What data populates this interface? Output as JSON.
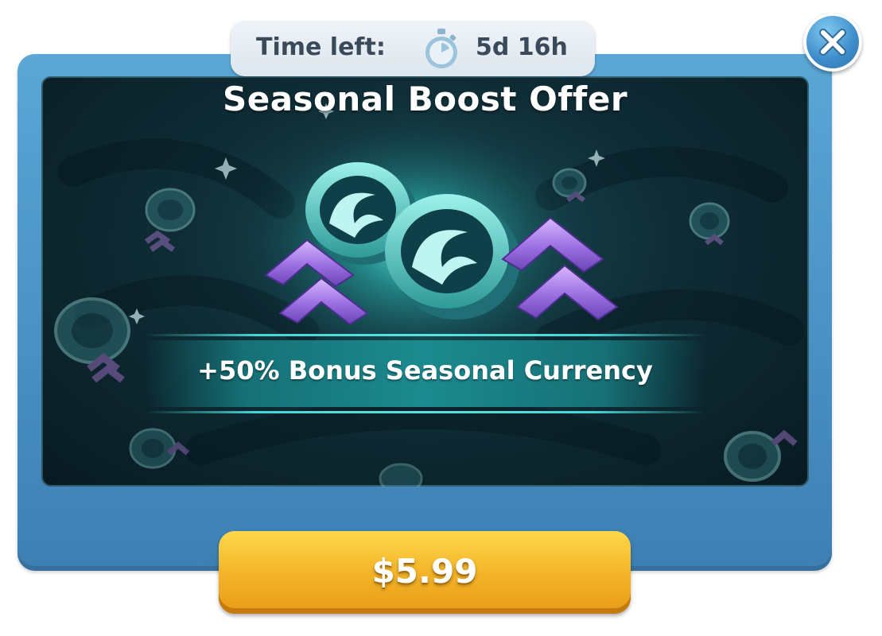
{
  "timer": {
    "label": "Time left:",
    "icon": "stopwatch-icon",
    "value": "5d 16h"
  },
  "offer": {
    "title": "Seasonal Boost Offer",
    "bonus_text": "+50% Bonus Seasonal Currency",
    "artwork": [
      "wave-coin-icon",
      "wave-coin-icon",
      "boost-arrows-icon",
      "boost-arrows-icon"
    ]
  },
  "buy_button": {
    "price": "$5.99"
  },
  "close_button": {
    "icon": "close-icon"
  },
  "colors": {
    "frame": "#4a91c4",
    "panel": "#0f2d36",
    "accent_teal": "#1b8a8e",
    "glow": "#48d6d2",
    "arrow_purple": "#9b6fe0",
    "button_gold": "#f4b52a",
    "timer_bg": "#e6edf3"
  }
}
